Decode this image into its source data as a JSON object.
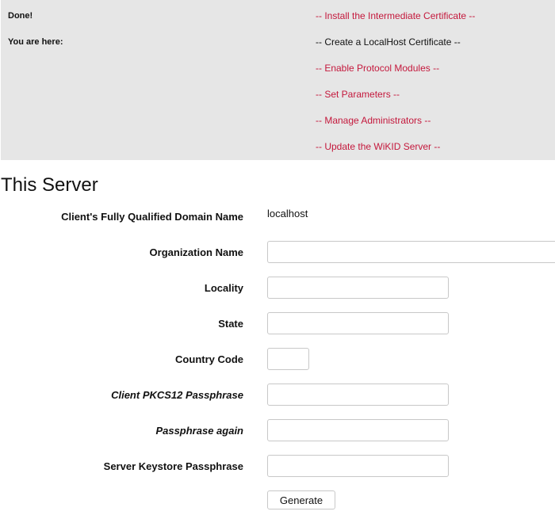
{
  "status": {
    "done_label": "Done!",
    "location_label": "You are here:"
  },
  "steps": [
    {
      "label": "-- Install the Intermediate Certificate --",
      "current": false
    },
    {
      "label": "-- Create a LocalHost Certificate --",
      "current": true
    },
    {
      "label": "-- Enable Protocol Modules --",
      "current": false
    },
    {
      "label": "-- Set Parameters --",
      "current": false
    },
    {
      "label": "-- Manage Administrators --",
      "current": false
    },
    {
      "label": "-- Update the WiKID Server --",
      "current": false
    }
  ],
  "colors": {
    "link": "#c4183c",
    "panel_bg": "#e6e6e6"
  },
  "page_title": "This Server",
  "form": {
    "fqdn_label": "Client's Fully Qualified Domain Name",
    "fqdn_value": "localhost",
    "organization_label": "Organization Name",
    "organization_value": "",
    "locality_label": "Locality",
    "locality_value": "",
    "state_label": "State",
    "state_value": "",
    "country_label": "Country Code",
    "country_value": "",
    "pkcs12_label": "Client PKCS12 Passphrase",
    "pkcs12_value": "",
    "passphrase_again_label": "Passphrase again",
    "passphrase_again_value": "",
    "keystore_label": "Server Keystore Passphrase",
    "keystore_value": "",
    "generate_label": "Generate"
  }
}
